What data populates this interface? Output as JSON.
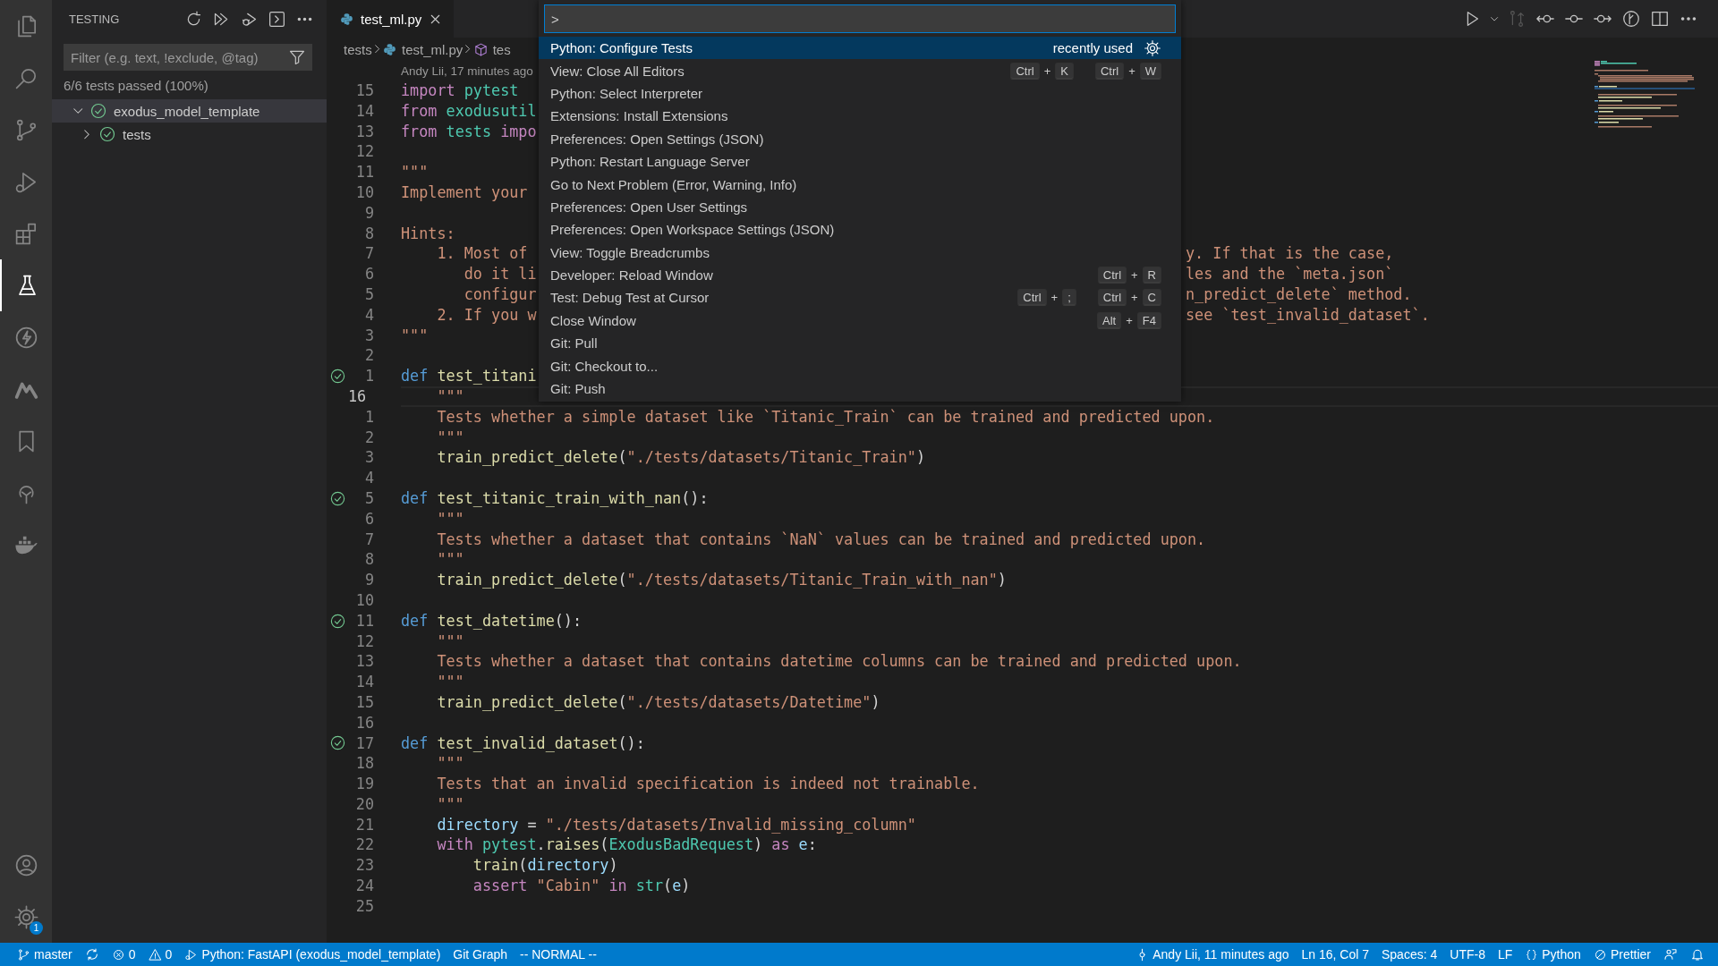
{
  "activity_bar": {
    "items": [
      {
        "kind": "explorer",
        "selected": false
      },
      {
        "kind": "search",
        "selected": false
      },
      {
        "kind": "source-control",
        "selected": false
      },
      {
        "kind": "run-debug",
        "selected": false
      },
      {
        "kind": "extensions",
        "selected": false
      },
      {
        "kind": "testing",
        "selected": true
      },
      {
        "kind": "lightning",
        "selected": false
      },
      {
        "kind": "m-logo",
        "selected": false
      },
      {
        "kind": "bookmark",
        "selected": false
      },
      {
        "kind": "tree",
        "selected": false
      },
      {
        "kind": "whale",
        "selected": false
      }
    ],
    "bottom": [
      {
        "kind": "account"
      },
      {
        "kind": "settings",
        "badge": "1"
      }
    ]
  },
  "sidebar": {
    "title": "TESTING",
    "actions": [
      {
        "kind": "refresh"
      },
      {
        "kind": "run-all"
      },
      {
        "kind": "debug-all"
      },
      {
        "kind": "terminal"
      },
      {
        "kind": "more"
      }
    ],
    "filter": {
      "placeholder": "Filter (e.g. text, !exclude, @tag)"
    },
    "summary": "6/6 tests passed (100%)",
    "tree": [
      {
        "label": "exodus_model_template",
        "passed": true,
        "expanded": true,
        "selected": true,
        "children": [
          {
            "label": "tests",
            "passed": true,
            "expanded": false,
            "selected": false
          }
        ]
      }
    ]
  },
  "editor": {
    "tabs": [
      {
        "label": "test_ml.py",
        "selected": true
      }
    ],
    "breadcrumbs": [
      {
        "kind": "folder",
        "text": "tests"
      },
      {
        "kind": "file",
        "text": "test_ml.py"
      },
      {
        "kind": "symbol",
        "text": "tes"
      }
    ],
    "actions": [
      {
        "kind": "run",
        "disabled": false
      },
      {
        "kind": "dropdown",
        "disabled": false
      },
      {
        "kind": "compare",
        "disabled": true
      },
      {
        "kind": "back",
        "disabled": false
      },
      {
        "kind": "commit-line",
        "disabled": false
      },
      {
        "kind": "forward",
        "disabled": false
      },
      {
        "kind": "graph",
        "disabled": false
      },
      {
        "kind": "split",
        "disabled": false
      },
      {
        "kind": "more",
        "disabled": false
      }
    ],
    "blame": "Andy Lii, 17 minutes ago",
    "lines": [
      {
        "number": "15",
        "current": false,
        "test_passed": false,
        "tokens": [
          {
            "kind": "keyword",
            "text": "import "
          },
          {
            "kind": "type",
            "text": "pytest"
          }
        ]
      },
      {
        "number": "14",
        "current": false,
        "test_passed": false,
        "tokens": [
          {
            "kind": "keyword",
            "text": "from "
          },
          {
            "kind": "type",
            "text": "exodusutil"
          }
        ]
      },
      {
        "number": "13",
        "current": false,
        "test_passed": false,
        "tokens": [
          {
            "kind": "keyword",
            "text": "from "
          },
          {
            "kind": "type",
            "text": "tests "
          },
          {
            "kind": "keyword",
            "text": "impo"
          }
        ]
      },
      {
        "number": "12",
        "current": false,
        "test_passed": false
      },
      {
        "number": "11",
        "current": false,
        "test_passed": false,
        "tokens": [
          {
            "kind": "string",
            "text": "\"\"\""
          }
        ]
      },
      {
        "number": "10",
        "current": false,
        "test_passed": false,
        "tokens": [
          {
            "kind": "string",
            "text": "Implement your"
          }
        ]
      },
      {
        "number": "9",
        "current": false,
        "test_passed": false
      },
      {
        "number": "8",
        "current": false,
        "test_passed": false,
        "tokens": [
          {
            "kind": "string",
            "text": "Hints:"
          }
        ]
      },
      {
        "number": "7",
        "current": false,
        "test_passed": false,
        "tokens": [
          {
            "kind": "string",
            "text": "    1. Most of"
          }
        ],
        "tail": [
          {
            "kind": "string",
            "text": "y. If that is the case,"
          }
        ]
      },
      {
        "number": "6",
        "current": false,
        "test_passed": false,
        "tokens": [
          {
            "kind": "string",
            "text": "       do it li"
          }
        ],
        "tail": [
          {
            "kind": "string",
            "text": "les and the `meta.json`"
          }
        ]
      },
      {
        "number": "5",
        "current": false,
        "test_passed": false,
        "tokens": [
          {
            "kind": "string",
            "text": "       configur"
          }
        ],
        "tail": [
          {
            "kind": "string",
            "text": "n_predict_delete` method."
          }
        ]
      },
      {
        "number": "4",
        "current": false,
        "test_passed": false,
        "tokens": [
          {
            "kind": "string",
            "text": "    2. If you w"
          }
        ],
        "tail": [
          {
            "kind": "string",
            "text": "see `test_invalid_dataset`."
          }
        ]
      },
      {
        "number": "3",
        "current": false,
        "test_passed": false,
        "tokens": [
          {
            "kind": "string",
            "text": "\"\"\""
          }
        ]
      },
      {
        "number": "2",
        "current": false,
        "test_passed": false
      },
      {
        "number": "1",
        "current": false,
        "test_passed": true,
        "tokens": [
          {
            "kind": "storage",
            "text": "def "
          },
          {
            "kind": "function",
            "text": "test_titani"
          }
        ]
      },
      {
        "number": "16",
        "current": true,
        "test_passed": false,
        "tokens": [
          {
            "kind": "string",
            "text": "    \"\"\""
          }
        ]
      },
      {
        "number": "1",
        "current": false,
        "test_passed": false,
        "tokens": [
          {
            "kind": "string",
            "text": "    Tests whether a simple dataset like `Titanic_Train` can be trained and predicted upon."
          }
        ]
      },
      {
        "number": "2",
        "current": false,
        "test_passed": false,
        "tokens": [
          {
            "kind": "string",
            "text": "    \"\"\""
          }
        ]
      },
      {
        "number": "3",
        "current": false,
        "test_passed": false,
        "tokens": [
          {
            "kind": "function",
            "text": "    train_predict_delete"
          },
          {
            "kind": "plain",
            "text": "("
          },
          {
            "kind": "string",
            "text": "\"./tests/datasets/Titanic_Train\""
          },
          {
            "kind": "plain",
            "text": ")"
          }
        ]
      },
      {
        "number": "4",
        "current": false,
        "test_passed": false
      },
      {
        "number": "5",
        "current": false,
        "test_passed": true,
        "tokens": [
          {
            "kind": "storage",
            "text": "def "
          },
          {
            "kind": "function",
            "text": "test_titanic_train_with_nan"
          },
          {
            "kind": "plain",
            "text": "():"
          }
        ]
      },
      {
        "number": "6",
        "current": false,
        "test_passed": false,
        "tokens": [
          {
            "kind": "string",
            "text": "    \"\"\""
          }
        ]
      },
      {
        "number": "7",
        "current": false,
        "test_passed": false,
        "tokens": [
          {
            "kind": "string",
            "text": "    Tests whether a dataset that contains `NaN` values can be trained and predicted upon."
          }
        ]
      },
      {
        "number": "8",
        "current": false,
        "test_passed": false,
        "tokens": [
          {
            "kind": "string",
            "text": "    \"\"\""
          }
        ]
      },
      {
        "number": "9",
        "current": false,
        "test_passed": false,
        "tokens": [
          {
            "kind": "function",
            "text": "    train_predict_delete"
          },
          {
            "kind": "plain",
            "text": "("
          },
          {
            "kind": "string",
            "text": "\"./tests/datasets/Titanic_Train_with_nan\""
          },
          {
            "kind": "plain",
            "text": ")"
          }
        ]
      },
      {
        "number": "10",
        "current": false,
        "test_passed": false
      },
      {
        "number": "11",
        "current": false,
        "test_passed": true,
        "tokens": [
          {
            "kind": "storage",
            "text": "def "
          },
          {
            "kind": "function",
            "text": "test_datetime"
          },
          {
            "kind": "plain",
            "text": "():"
          }
        ]
      },
      {
        "number": "12",
        "current": false,
        "test_passed": false,
        "tokens": [
          {
            "kind": "string",
            "text": "    \"\"\""
          }
        ]
      },
      {
        "number": "13",
        "current": false,
        "test_passed": false,
        "tokens": [
          {
            "kind": "string",
            "text": "    Tests whether a dataset that contains datetime columns can be trained and predicted upon."
          }
        ]
      },
      {
        "number": "14",
        "current": false,
        "test_passed": false,
        "tokens": [
          {
            "kind": "string",
            "text": "    \"\"\""
          }
        ]
      },
      {
        "number": "15",
        "current": false,
        "test_passed": false,
        "tokens": [
          {
            "kind": "function",
            "text": "    train_predict_delete"
          },
          {
            "kind": "plain",
            "text": "("
          },
          {
            "kind": "string",
            "text": "\"./tests/datasets/Datetime\""
          },
          {
            "kind": "plain",
            "text": ")"
          }
        ]
      },
      {
        "number": "16",
        "current": false,
        "test_passed": false
      },
      {
        "number": "17",
        "current": false,
        "test_passed": true,
        "tokens": [
          {
            "kind": "storage",
            "text": "def "
          },
          {
            "kind": "function",
            "text": "test_invalid_dataset"
          },
          {
            "kind": "plain",
            "text": "():"
          }
        ]
      },
      {
        "number": "18",
        "current": false,
        "test_passed": false,
        "tokens": [
          {
            "kind": "string",
            "text": "    \"\"\""
          }
        ]
      },
      {
        "number": "19",
        "current": false,
        "test_passed": false,
        "tokens": [
          {
            "kind": "string",
            "text": "    Tests that an invalid specification is indeed not trainable."
          }
        ]
      },
      {
        "number": "20",
        "current": false,
        "test_passed": false,
        "tokens": [
          {
            "kind": "string",
            "text": "    \"\"\""
          }
        ]
      },
      {
        "number": "21",
        "current": false,
        "test_passed": false,
        "tokens": [
          {
            "kind": "variable",
            "text": "    directory"
          },
          {
            "kind": "plain",
            "text": " = "
          },
          {
            "kind": "string",
            "text": "\"./tests/datasets/Invalid_missing_column\""
          }
        ]
      },
      {
        "number": "22",
        "current": false,
        "test_passed": false,
        "tokens": [
          {
            "kind": "keyword",
            "text": "    with "
          },
          {
            "kind": "type",
            "text": "pytest"
          },
          {
            "kind": "plain",
            "text": "."
          },
          {
            "kind": "function",
            "text": "raises"
          },
          {
            "kind": "plain",
            "text": "("
          },
          {
            "kind": "type",
            "text": "ExodusBadRequest"
          },
          {
            "kind": "plain",
            "text": ") "
          },
          {
            "kind": "keyword",
            "text": "as "
          },
          {
            "kind": "variable",
            "text": "e"
          },
          {
            "kind": "plain",
            "text": ":"
          }
        ]
      },
      {
        "number": "23",
        "current": false,
        "test_passed": false,
        "tokens": [
          {
            "kind": "function",
            "text": "        train"
          },
          {
            "kind": "plain",
            "text": "("
          },
          {
            "kind": "variable",
            "text": "directory"
          },
          {
            "kind": "plain",
            "text": ")"
          }
        ]
      },
      {
        "number": "24",
        "current": false,
        "test_passed": false,
        "tokens": [
          {
            "kind": "keyword",
            "text": "        assert "
          },
          {
            "kind": "string",
            "text": "\"Cabin\""
          },
          {
            "kind": "keyword",
            "text": " in "
          },
          {
            "kind": "type",
            "text": "str"
          },
          {
            "kind": "plain",
            "text": "("
          },
          {
            "kind": "variable",
            "text": "e"
          },
          {
            "kind": "plain",
            "text": ")"
          }
        ]
      },
      {
        "number": "25",
        "current": false,
        "test_passed": false
      }
    ]
  },
  "command_palette": {
    "input": {
      "value": ">"
    },
    "items": [
      {
        "label": "Python: Configure Tests",
        "selected": true,
        "detail": "recently used"
      },
      {
        "label": "View: Close All Editors",
        "selected": false,
        "chords": [
          [
            "Ctrl",
            "+",
            "K"
          ],
          [
            "Ctrl",
            "+",
            "W"
          ]
        ]
      },
      {
        "label": "Python: Select Interpreter",
        "selected": false
      },
      {
        "label": "Extensions: Install Extensions",
        "selected": false
      },
      {
        "label": "Preferences: Open Settings (JSON)",
        "selected": false
      },
      {
        "label": "Python: Restart Language Server",
        "selected": false
      },
      {
        "label": "Go to Next Problem (Error, Warning, Info)",
        "selected": false
      },
      {
        "label": "Preferences: Open User Settings",
        "selected": false
      },
      {
        "label": "Preferences: Open Workspace Settings (JSON)",
        "selected": false
      },
      {
        "label": "View: Toggle Breadcrumbs",
        "selected": false
      },
      {
        "label": "Developer: Reload Window",
        "selected": false,
        "chords": [
          [
            "Ctrl",
            "+",
            "R"
          ]
        ]
      },
      {
        "label": "Test: Debug Test at Cursor",
        "selected": false,
        "chords": [
          [
            "Ctrl",
            "+",
            ";"
          ],
          [
            "Ctrl",
            "+",
            "C"
          ]
        ]
      },
      {
        "label": "Close Window",
        "selected": false,
        "chords": [
          [
            "Alt",
            "+",
            "F4"
          ]
        ]
      },
      {
        "label": "Git: Pull",
        "selected": false
      },
      {
        "label": "Git: Checkout to...",
        "selected": false
      },
      {
        "label": "Git: Push",
        "selected": false
      }
    ]
  },
  "status_bar": {
    "left": [
      {
        "kind": "branch",
        "text": "master"
      },
      {
        "kind": "sync"
      },
      {
        "kind": "errors",
        "text": "0"
      },
      {
        "kind": "warnings",
        "text": "0"
      },
      {
        "kind": "debug-config",
        "text": "Python: FastAPI (exodus_model_template)"
      },
      {
        "kind": "text",
        "text": "Git Graph"
      },
      {
        "kind": "text",
        "text": "-- NORMAL --"
      }
    ],
    "right": [
      {
        "kind": "commit",
        "text": "Andy Lii, 11 minutes ago"
      },
      {
        "kind": "text",
        "text": "Ln 16, Col 7"
      },
      {
        "kind": "text",
        "text": "Spaces: 4"
      },
      {
        "kind": "text",
        "text": "UTF-8"
      },
      {
        "kind": "text",
        "text": "LF"
      },
      {
        "kind": "language",
        "text": "Python"
      },
      {
        "kind": "prettier",
        "text": "Prettier"
      },
      {
        "kind": "feedback"
      },
      {
        "kind": "bell"
      }
    ]
  }
}
